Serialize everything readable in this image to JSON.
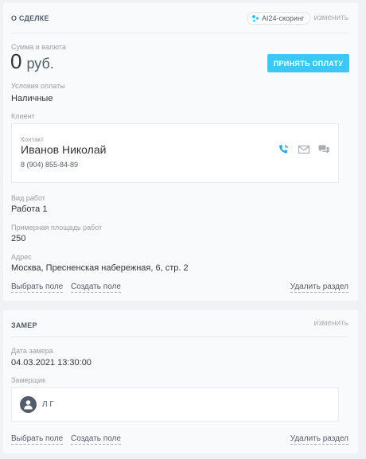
{
  "deal": {
    "title": "О СДЕЛКЕ",
    "ai_badge": "AI24-скоринг",
    "edit": "изменить",
    "amount_label": "Сумма и валюта",
    "amount_value": "0",
    "amount_currency": "руб.",
    "pay_button": "ПРИНЯТЬ ОПЛАТУ",
    "payment_terms_label": "Условия оплаты",
    "payment_terms_value": "Наличные",
    "client_label": "Клиент",
    "contact": {
      "label": "Контакт",
      "name": "Иванов Николай",
      "phone": "8 (904) 855-84-89",
      "icons": [
        "phone-icon",
        "email-icon",
        "chat-icon"
      ]
    },
    "work_type_label": "Вид работ",
    "work_type_value": "Работа 1",
    "area_label": "Примерная площадь работ",
    "area_value": "250",
    "address_label": "Адрес",
    "address_value": "Москва, Пресненская набережная, 6, стр. 2",
    "select_field": "Выбрать поле",
    "create_field": "Создать поле",
    "delete_section": "Удалить раздел"
  },
  "measure": {
    "title": "ЗАМЕР",
    "edit": "изменить",
    "date_label": "Дата замера",
    "date_value": "04.03.2021 13:30:00",
    "measurer_label": "Замерщик",
    "measurer_name": "Л Г",
    "select_field": "Выбрать поле",
    "create_field": "Создать поле",
    "delete_section": "Удалить раздел"
  },
  "colors": {
    "accent": "#3bc8f5",
    "phone_icon": "#2fa3d9",
    "background": "#eef2f4",
    "card": "#f9fafb"
  }
}
